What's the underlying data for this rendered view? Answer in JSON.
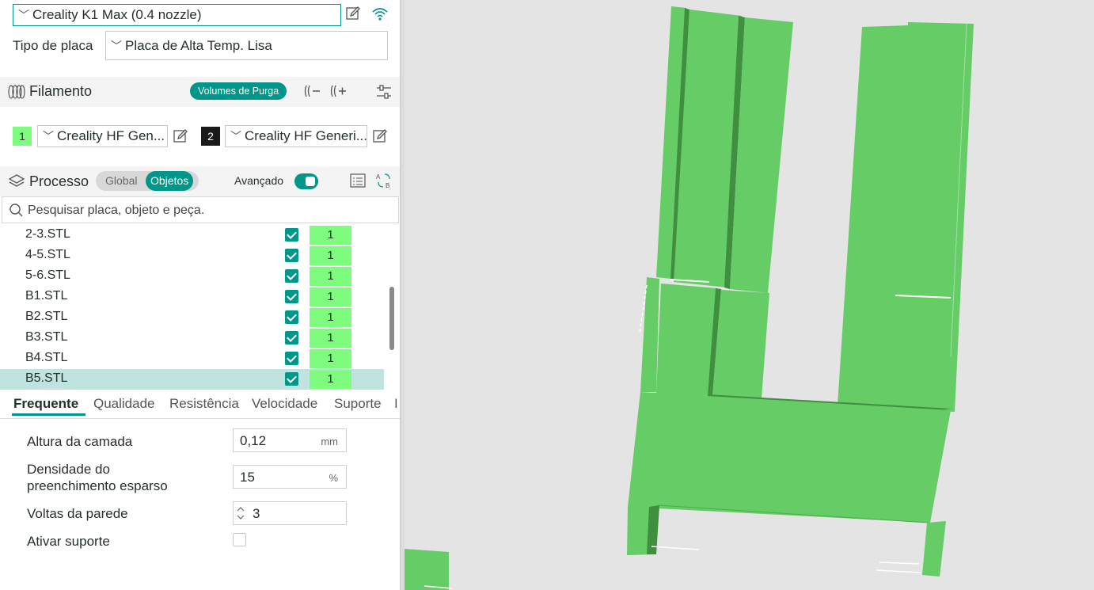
{
  "printer": {
    "name": "Creality K1 Max (0.4 nozzle)"
  },
  "plate": {
    "label": "Tipo de placa",
    "value": "Placa de Alta Temp. Lisa"
  },
  "filament": {
    "title": "Filamento",
    "purge_button": "Volumes de Purga",
    "slots": [
      {
        "index": "1",
        "name": "Creality HF Gen...",
        "color": "#7dfc7d"
      },
      {
        "index": "2",
        "name": "Creality HF Generi...",
        "color": "#1a1a1a"
      }
    ]
  },
  "process": {
    "title": "Processo",
    "toggle_global": "Global",
    "toggle_objects": "Objetos",
    "advanced_label": "Avançado"
  },
  "search": {
    "placeholder": "Pesquisar placa, objeto e peça."
  },
  "objects": [
    {
      "name": "2-3.STL",
      "extruder": "1"
    },
    {
      "name": "4-5.STL",
      "extruder": "1"
    },
    {
      "name": "5-6.STL",
      "extruder": "1"
    },
    {
      "name": "B1.STL",
      "extruder": "1"
    },
    {
      "name": "B2.STL",
      "extruder": "1"
    },
    {
      "name": "B3.STL",
      "extruder": "1"
    },
    {
      "name": "B4.STL",
      "extruder": "1"
    },
    {
      "name": "B5.STL",
      "extruder": "1"
    }
  ],
  "tabs": [
    "Frequente",
    "Qualidade",
    "Resistência",
    "Velocidade",
    "Suporte",
    "I"
  ],
  "params": {
    "layer_height": {
      "label": "Altura da camada",
      "value": "0,12",
      "unit": "mm"
    },
    "infill": {
      "label_line1": "Densidade do",
      "label_line2": "preenchimento esparso",
      "value": "15",
      "unit": "%"
    },
    "walls": {
      "label": "Voltas da parede",
      "value": "3"
    },
    "support": {
      "label": "Ativar suporte"
    }
  },
  "colors": {
    "accent": "#00968a",
    "model": "#66cc66",
    "model_dark": "#3f8f3f",
    "background_3d": "#e4e4e4"
  }
}
